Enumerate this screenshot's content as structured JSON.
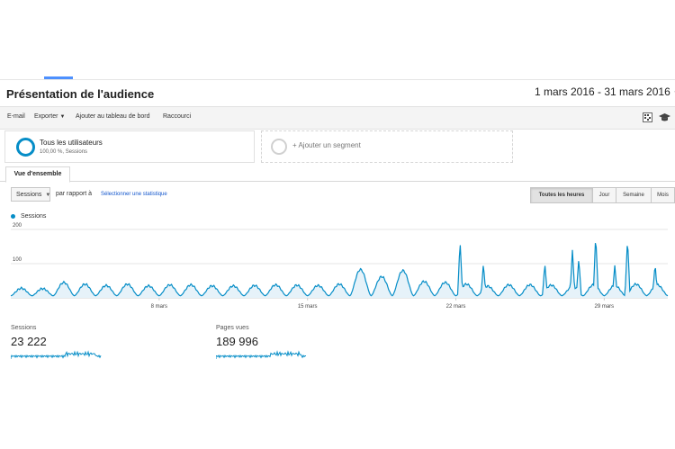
{
  "header": {
    "title": "Présentation de l'audience",
    "date_range": "1 mars 2016 - 31 mars 2016"
  },
  "toolbar": {
    "email": "E-mail",
    "export": "Exporter",
    "add_dashboard": "Ajouter au tableau de bord",
    "shortcut": "Raccourci"
  },
  "segments": {
    "all_users_title": "Tous les utilisateurs",
    "all_users_sub": "100,00 %, Sessions",
    "add_segment": "+ Ajouter un segment"
  },
  "overview_tab": "Vue d'ensemble",
  "controls": {
    "metric_select": "Sessions",
    "compare_label": "par rapport à",
    "select_stat_link": "Sélectionner une statistique",
    "granularity": [
      "Toutes les heures",
      "Jour",
      "Semaine",
      "Mois"
    ]
  },
  "colors": {
    "accent": "#058dc7",
    "link": "#1155cc"
  },
  "chart_data": {
    "type": "area",
    "series_name": "Sessions",
    "ylim": [
      0,
      200
    ],
    "y_ticks": [
      100,
      200
    ],
    "x_ticks": [
      "8 mars",
      "15 mars",
      "22 mars",
      "29 mars"
    ],
    "x_unit": "day of month",
    "x_range": [
      1,
      32
    ],
    "daily_peaks": [
      28,
      27,
      45,
      40,
      36,
      40,
      35,
      38,
      38,
      35,
      35,
      36,
      38,
      37,
      36,
      40,
      83,
      62,
      80,
      48,
      45,
      40,
      34,
      38,
      38,
      37,
      32,
      38,
      36,
      40,
      38
    ],
    "spikes": [
      {
        "day": 22.2,
        "value": 165
      },
      {
        "day": 23.3,
        "value": 100
      },
      {
        "day": 26.2,
        "value": 100
      },
      {
        "day": 27.5,
        "value": 140
      },
      {
        "day": 27.8,
        "value": 115
      },
      {
        "day": 28.6,
        "value": 185
      },
      {
        "day": 29.5,
        "value": 95
      },
      {
        "day": 30.1,
        "value": 175
      },
      {
        "day": 31.4,
        "value": 100
      }
    ]
  },
  "metrics": [
    {
      "label": "Sessions",
      "value": "23 222"
    },
    {
      "label": "Pages vues",
      "value": "189 996"
    }
  ]
}
